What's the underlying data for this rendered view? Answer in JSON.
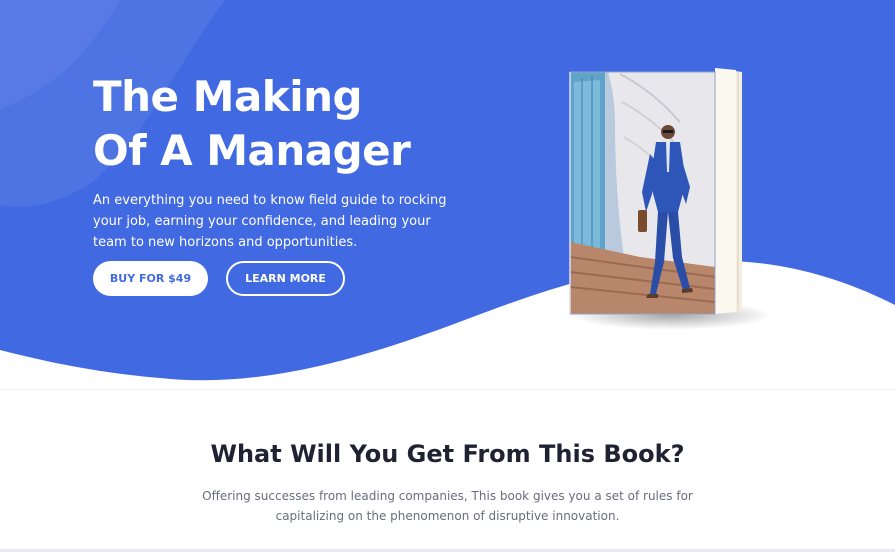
{
  "hero": {
    "title_line1": "The Making",
    "title_line2": "Of A Manager",
    "description": "An everything you need to know field guide to rocking your job, earning your confidence, and leading your team to new horizons and opportunities.",
    "buy_button_label": "BUY FOR $49",
    "learn_more_label": "LEARN MORE"
  },
  "section": {
    "title": "What Will You Get From This Book?",
    "description": "Offering successes from leading companies, This book gives you a set of rules for capitalizing on the phenomenon of disruptive innovation."
  },
  "colors": {
    "hero_blue": "#4169e1",
    "heading_dark": "#1f2233",
    "body_gray": "#6a6d7c"
  },
  "icons": {
    "book_cover": "book-cover-image"
  }
}
